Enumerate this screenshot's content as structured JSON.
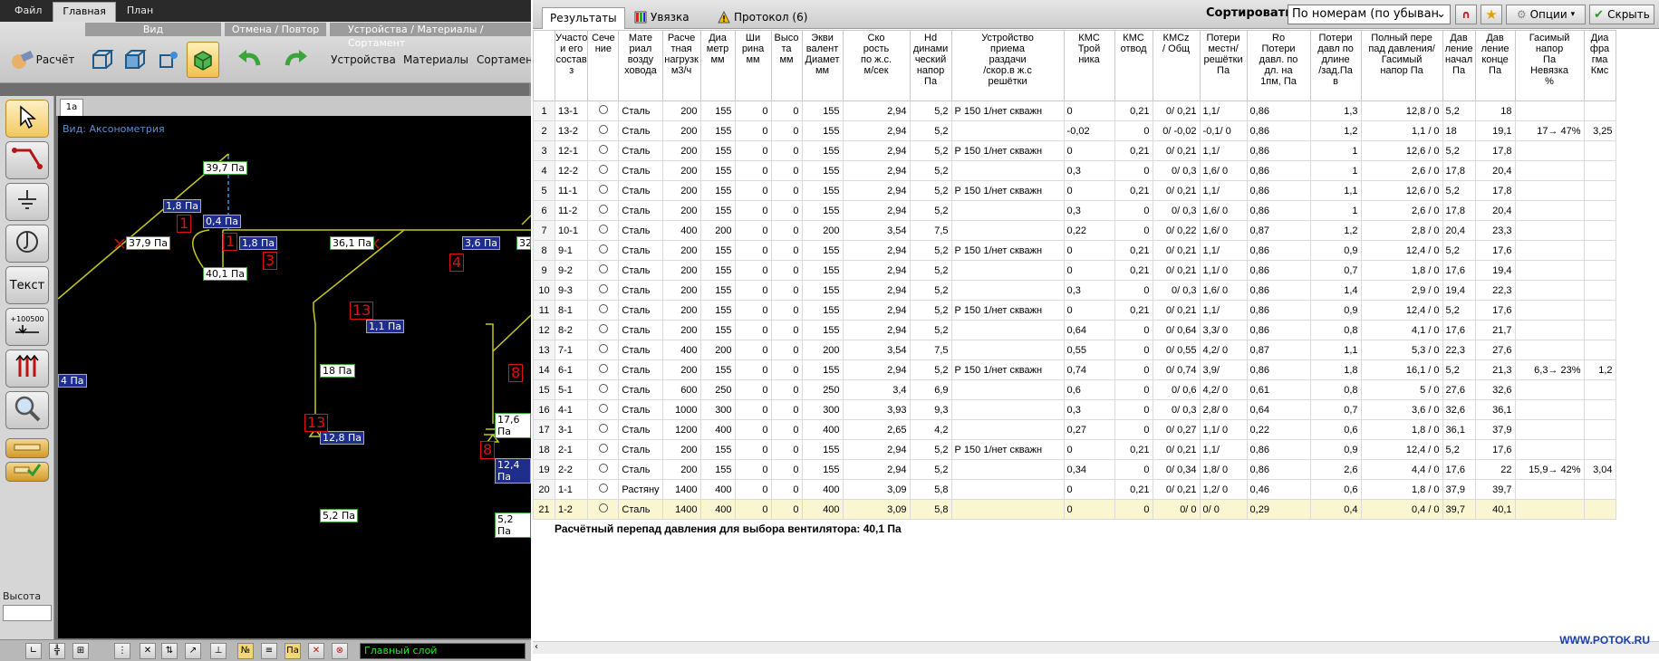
{
  "menu": {
    "items": [
      "Файл",
      "Главная",
      "План"
    ],
    "active": "Главная"
  },
  "ribbon": {
    "group_view": "Вид",
    "group_undo": "Отмена / Повтор",
    "group_devices": "Устройства / Материалы / Сортамент",
    "calc_label": "Расчёт",
    "devices_label": "Устройства",
    "materials_label": "Материалы",
    "sortament_label": "Сортамент"
  },
  "tools": {
    "text_label": "Текст",
    "level_label": "+100500",
    "height_label": "Высота мм:",
    "height_value": ""
  },
  "canvas": {
    "tab": "1а",
    "view_label": "Вид: Аксонометрия",
    "labels": [
      {
        "id": "l1",
        "text": "39,7 Па"
      },
      {
        "id": "l2",
        "text": "1,8 Па"
      },
      {
        "id": "l3",
        "text": "0,4 Па"
      },
      {
        "id": "l4",
        "text": "1,8 Па"
      },
      {
        "id": "l5",
        "text": "37,9 Па"
      },
      {
        "id": "l6",
        "text": "40,1 Па"
      },
      {
        "id": "l7",
        "text": "36,1 Па"
      },
      {
        "id": "l8",
        "text": "3,6 Па"
      },
      {
        "id": "l9",
        "text": "32,"
      },
      {
        "id": "l10",
        "text": "1,1 Па"
      },
      {
        "id": "l11",
        "text": "18 Па"
      },
      {
        "id": "l12",
        "text": "12,8 Па"
      },
      {
        "id": "l13",
        "text": "5,2 Па"
      },
      {
        "id": "l14",
        "text": "4 Па"
      },
      {
        "id": "l15",
        "text": "17,6 Па"
      },
      {
        "id": "l16",
        "text": "12,4 Па"
      },
      {
        "id": "l17",
        "text": "5,2 Па"
      }
    ],
    "nodes": [
      "1",
      "1",
      "3",
      "4",
      "13",
      "13",
      "8",
      "8"
    ]
  },
  "status": {
    "layer": "Главный слой",
    "btn_no": "№",
    "btn_pa": "Па"
  },
  "results": {
    "tabs": [
      "Результаты",
      "Увязка",
      "Протокол (6)"
    ],
    "sort_label": "Сортировать",
    "sort_value": "По номерам (по убыван",
    "options_label": "Опции",
    "hide_label": "Скрыть",
    "columns": [
      "Участо\nи его\nсостав з",
      "Сече\nние",
      "Мате\nриал\nвозду\nховода",
      "Расче\nтная\nнагрузк\nм3/ч",
      "Диа\nметр\nмм",
      "Ши\nрина\nмм",
      "Высо\nта\nмм",
      "Экви\nвалент\nДиамет\nмм",
      "Ско\nрость\nпо ж.с.\nм/сек",
      "Hd\nдинами\nческий\nнапор\nПа",
      "Устройство\nприема\nраздачи\n/скор.в ж.с\nрешётки",
      "КМС\nТрой\nника",
      "КМС\nотвод",
      "КМСz\n/ Общ",
      "Потери\nместн/\nрешётки\nПа",
      "Ro\nПотери\nдавл. по\nдл. на\n1пм, Па",
      "Потери\nдавл по\nдлине\n/зад.Па\nв",
      "Полный пере\nпад давления/\nГасимый\nнапор Па",
      "Дав\nление\nначал\nПа",
      "Дав\nление\nконце\nПа",
      "Гасимый\nнапор\nПа\nНевязка\n%",
      "Диа\nфра\nгма\nКмс"
    ],
    "rows": [
      [
        "1",
        "13-1",
        "Сталь",
        "200",
        "155",
        "0",
        "0",
        "155",
        "2,94",
        "5,2",
        "Р 150 1/нет скважн",
        "0",
        "0,21",
        "0/ 0,21",
        "1,1/",
        "0,86",
        "1,3",
        "12,8 / 0",
        "5,2",
        "18",
        "",
        ""
      ],
      [
        "2",
        "13-2",
        "Сталь",
        "200",
        "155",
        "0",
        "0",
        "155",
        "2,94",
        "5,2",
        "",
        "-0,02",
        "0",
        "0/ -0,02",
        "-0,1/ 0",
        "0,86",
        "1,2",
        "1,1 / 0",
        "18",
        "19,1",
        "17→ 47%",
        "3,25"
      ],
      [
        "3",
        "12-1",
        "Сталь",
        "200",
        "155",
        "0",
        "0",
        "155",
        "2,94",
        "5,2",
        "Р 150 1/нет скважн",
        "0",
        "0,21",
        "0/ 0,21",
        "1,1/",
        "0,86",
        "1",
        "12,6 / 0",
        "5,2",
        "17,8",
        "",
        ""
      ],
      [
        "4",
        "12-2",
        "Сталь",
        "200",
        "155",
        "0",
        "0",
        "155",
        "2,94",
        "5,2",
        "",
        "0,3",
        "0",
        "0/ 0,3",
        "1,6/ 0",
        "0,86",
        "1",
        "2,6 / 0",
        "17,8",
        "20,4",
        "",
        ""
      ],
      [
        "5",
        "11-1",
        "Сталь",
        "200",
        "155",
        "0",
        "0",
        "155",
        "2,94",
        "5,2",
        "Р 150 1/нет скважн",
        "0",
        "0,21",
        "0/ 0,21",
        "1,1/",
        "0,86",
        "1,1",
        "12,6 / 0",
        "5,2",
        "17,8",
        "",
        ""
      ],
      [
        "6",
        "11-2",
        "Сталь",
        "200",
        "155",
        "0",
        "0",
        "155",
        "2,94",
        "5,2",
        "",
        "0,3",
        "0",
        "0/ 0,3",
        "1,6/ 0",
        "0,86",
        "1",
        "2,6 / 0",
        "17,8",
        "20,4",
        "",
        ""
      ],
      [
        "7",
        "10-1",
        "Сталь",
        "400",
        "200",
        "0",
        "0",
        "200",
        "3,54",
        "7,5",
        "",
        "0,22",
        "0",
        "0/ 0,22",
        "1,6/ 0",
        "0,87",
        "1,2",
        "2,8 / 0",
        "20,4",
        "23,3",
        "",
        ""
      ],
      [
        "8",
        "9-1",
        "Сталь",
        "200",
        "155",
        "0",
        "0",
        "155",
        "2,94",
        "5,2",
        "Р 150 1/нет скважн",
        "0",
        "0,21",
        "0/ 0,21",
        "1,1/",
        "0,86",
        "0,9",
        "12,4 / 0",
        "5,2",
        "17,6",
        "",
        ""
      ],
      [
        "9",
        "9-2",
        "Сталь",
        "200",
        "155",
        "0",
        "0",
        "155",
        "2,94",
        "5,2",
        "",
        "0",
        "0,21",
        "0/ 0,21",
        "1,1/ 0",
        "0,86",
        "0,7",
        "1,8 / 0",
        "17,6",
        "19,4",
        "",
        ""
      ],
      [
        "10",
        "9-3",
        "Сталь",
        "200",
        "155",
        "0",
        "0",
        "155",
        "2,94",
        "5,2",
        "",
        "0,3",
        "0",
        "0/ 0,3",
        "1,6/ 0",
        "0,86",
        "1,4",
        "2,9 / 0",
        "19,4",
        "22,3",
        "",
        ""
      ],
      [
        "11",
        "8-1",
        "Сталь",
        "200",
        "155",
        "0",
        "0",
        "155",
        "2,94",
        "5,2",
        "Р 150 1/нет скважн",
        "0",
        "0,21",
        "0/ 0,21",
        "1,1/",
        "0,86",
        "0,9",
        "12,4 / 0",
        "5,2",
        "17,6",
        "",
        ""
      ],
      [
        "12",
        "8-2",
        "Сталь",
        "200",
        "155",
        "0",
        "0",
        "155",
        "2,94",
        "5,2",
        "",
        "0,64",
        "0",
        "0/ 0,64",
        "3,3/ 0",
        "0,86",
        "0,8",
        "4,1 / 0",
        "17,6",
        "21,7",
        "",
        ""
      ],
      [
        "13",
        "7-1",
        "Сталь",
        "400",
        "200",
        "0",
        "0",
        "200",
        "3,54",
        "7,5",
        "",
        "0,55",
        "0",
        "0/ 0,55",
        "4,2/ 0",
        "0,87",
        "1,1",
        "5,3 / 0",
        "22,3",
        "27,6",
        "",
        ""
      ],
      [
        "14",
        "6-1",
        "Сталь",
        "200",
        "155",
        "0",
        "0",
        "155",
        "2,94",
        "5,2",
        "Р 150 1/нет скважн",
        "0,74",
        "0",
        "0/ 0,74",
        "3,9/",
        "0,86",
        "1,8",
        "16,1 / 0",
        "5,2",
        "21,3",
        "6,3→ 23%",
        "1,2"
      ],
      [
        "15",
        "5-1",
        "Сталь",
        "600",
        "250",
        "0",
        "0",
        "250",
        "3,4",
        "6,9",
        "",
        "0,6",
        "0",
        "0/ 0,6",
        "4,2/ 0",
        "0,61",
        "0,8",
        "5 / 0",
        "27,6",
        "32,6",
        "",
        ""
      ],
      [
        "16",
        "4-1",
        "Сталь",
        "1000",
        "300",
        "0",
        "0",
        "300",
        "3,93",
        "9,3",
        "",
        "0,3",
        "0",
        "0/ 0,3",
        "2,8/ 0",
        "0,64",
        "0,7",
        "3,6 / 0",
        "32,6",
        "36,1",
        "",
        ""
      ],
      [
        "17",
        "3-1",
        "Сталь",
        "1200",
        "400",
        "0",
        "0",
        "400",
        "2,65",
        "4,2",
        "",
        "0,27",
        "0",
        "0/ 0,27",
        "1,1/ 0",
        "0,22",
        "0,6",
        "1,8 / 0",
        "36,1",
        "37,9",
        "",
        ""
      ],
      [
        "18",
        "2-1",
        "Сталь",
        "200",
        "155",
        "0",
        "0",
        "155",
        "2,94",
        "5,2",
        "Р 150 1/нет скважн",
        "0",
        "0,21",
        "0/ 0,21",
        "1,1/",
        "0,86",
        "0,9",
        "12,4 / 0",
        "5,2",
        "17,6",
        "",
        ""
      ],
      [
        "19",
        "2-2",
        "Сталь",
        "200",
        "155",
        "0",
        "0",
        "155",
        "2,94",
        "5,2",
        "",
        "0,34",
        "0",
        "0/ 0,34",
        "1,8/ 0",
        "0,86",
        "2,6",
        "4,4 / 0",
        "17,6",
        "22",
        "15,9→ 42%",
        "3,04"
      ],
      [
        "20",
        "1-1",
        "Растяну",
        "1400",
        "400",
        "0",
        "0",
        "400",
        "3,09",
        "5,8",
        "",
        "0",
        "0,21",
        "0/ 0,21",
        "1,2/ 0",
        "0,46",
        "0,6",
        "1,8 / 0",
        "37,9",
        "39,7",
        "",
        ""
      ],
      [
        "21",
        "1-2",
        "Сталь",
        "1400",
        "400",
        "0",
        "0",
        "400",
        "3,09",
        "5,8",
        "",
        "0",
        "0",
        "0/ 0",
        "0/ 0",
        "0,29",
        "0,4",
        "0,4 / 0",
        "39,7",
        "40,1",
        "",
        ""
      ]
    ],
    "summary": "Расчётный перепад давления для выбора вентилятора: 40,1 Па",
    "site": "WWW.POTOK.RU"
  }
}
